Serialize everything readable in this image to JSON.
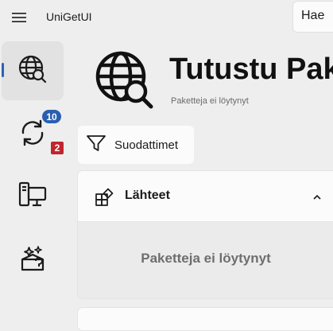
{
  "app": {
    "title": "UniGetUI"
  },
  "search": {
    "value": "Hae"
  },
  "nav": {
    "items": [
      {
        "name": "discover",
        "icon": "globe-search-icon",
        "active": true
      },
      {
        "name": "updates",
        "icon": "sync-icon",
        "badge": "10",
        "secondary_badge": "2"
      },
      {
        "name": "installed",
        "icon": "desktop-icon"
      },
      {
        "name": "bundles",
        "icon": "sparkle-box-icon"
      }
    ]
  },
  "page": {
    "title": "Tutustu Pak",
    "subtitle": "Paketteja ei löytynyt"
  },
  "toolbar": {
    "filters_label": "Suodattimet"
  },
  "sources": {
    "label": "Lähteet",
    "empty_message": "Paketteja ei löytynyt"
  },
  "colors": {
    "accent": "#2a5fb0",
    "badge_red": "#c0262d",
    "background": "#eeeeee"
  }
}
